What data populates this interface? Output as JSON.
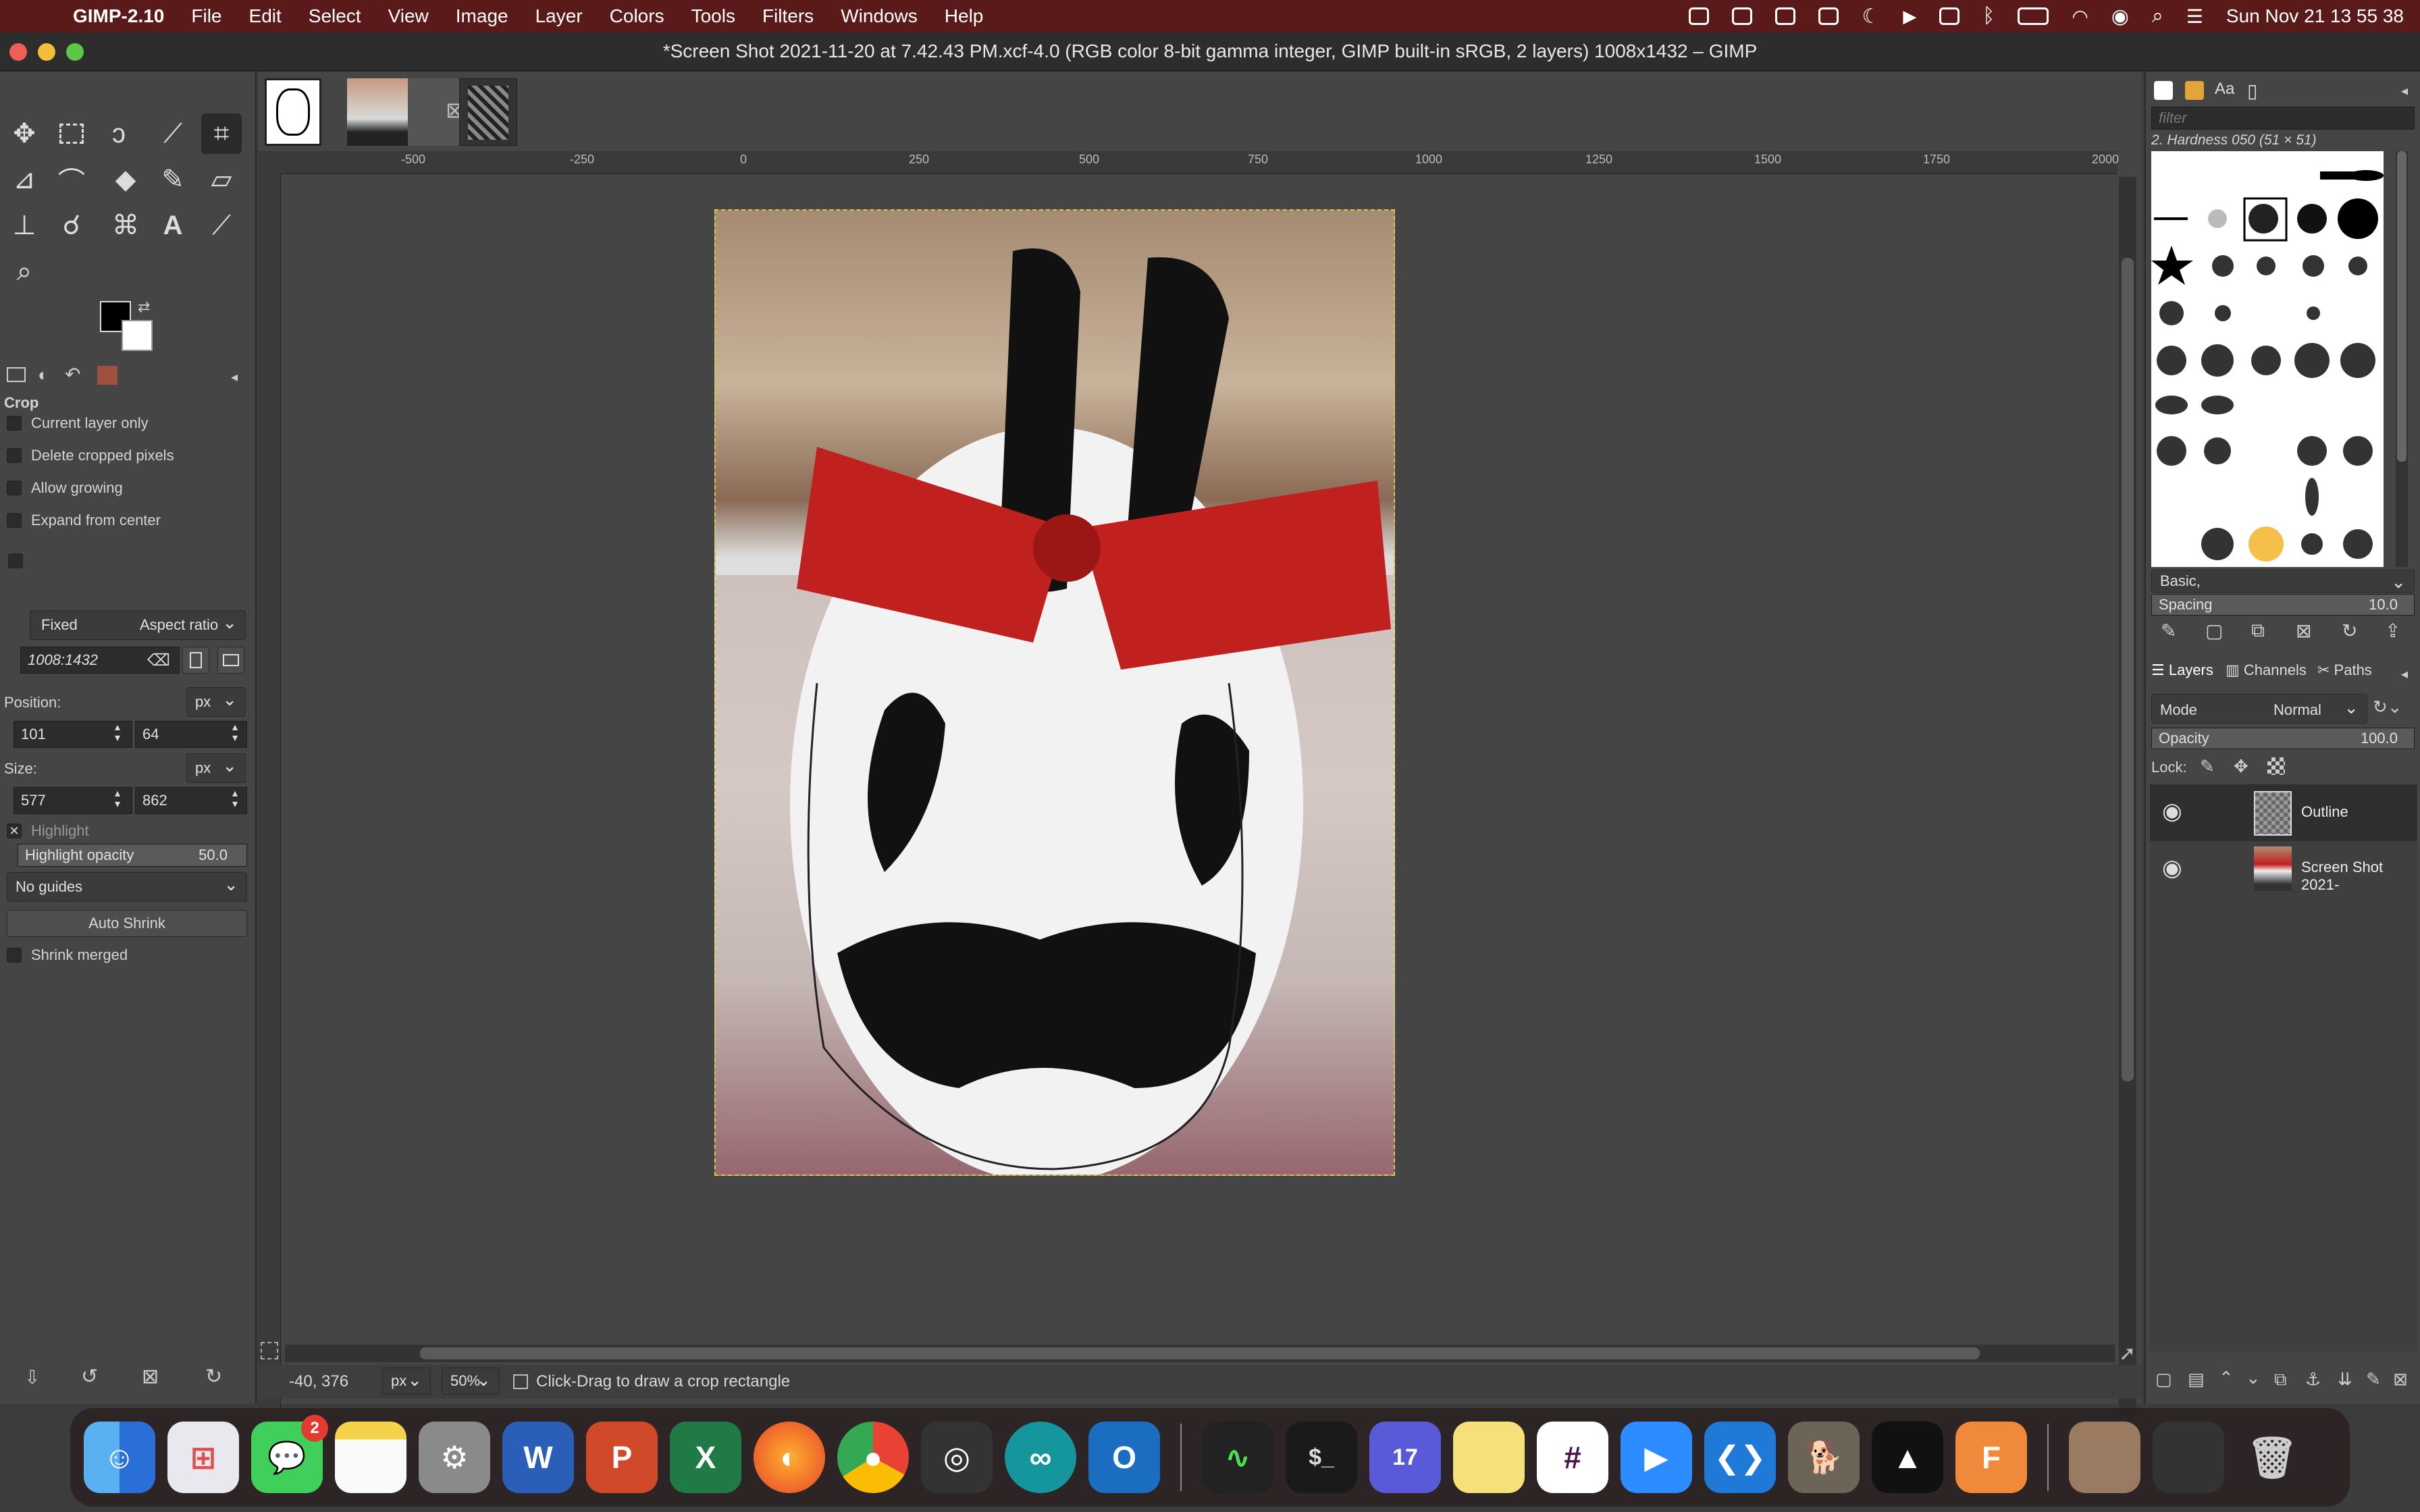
{
  "menubar": {
    "app": "GIMP-2.10",
    "items": [
      "File",
      "Edit",
      "Select",
      "View",
      "Image",
      "Layer",
      "Colors",
      "Tools",
      "Filters",
      "Windows",
      "Help"
    ],
    "clock": "Sun Nov 21  13 55 38"
  },
  "window": {
    "title": "*Screen Shot 2021-11-20 at 7.42.43 PM.xcf-4.0 (RGB color 8-bit gamma integer, GIMP built-in sRGB, 2 layers) 1008x1432 – GIMP"
  },
  "tool_options": {
    "tool_name": "Crop",
    "current_layer_only": "Current layer only",
    "delete_cropped": "Delete cropped pixels",
    "allow_growing": "Allow growing",
    "expand_center": "Expand from center",
    "fixed_label": "Fixed",
    "fixed_value": "Aspect ratio",
    "ratio": "1008:1432",
    "position_label": "Position:",
    "position_unit": "px",
    "pos_x": "101",
    "pos_y": "64",
    "size_label": "Size:",
    "size_unit": "px",
    "size_w": "577",
    "size_h": "862",
    "highlight": "Highlight",
    "highlight_opacity_label": "Highlight opacity",
    "highlight_opacity": "50.0",
    "guides": "No guides",
    "auto_shrink": "Auto Shrink",
    "shrink_merged": "Shrink merged"
  },
  "ruler_labels": [
    "-500",
    "-250",
    "0",
    "250",
    "500",
    "750",
    "1000",
    "1250",
    "1500",
    "1750",
    "2000"
  ],
  "status": {
    "coords": "-40, 376",
    "unit": "px",
    "zoom": "50%",
    "message": "Click-Drag to draw a crop rectangle"
  },
  "brushes": {
    "filter_placeholder": "filter",
    "selected": "2. Hardness 050 (51 × 51)",
    "preset": "Basic,",
    "spacing_label": "Spacing",
    "spacing": "10.0"
  },
  "layers_panel": {
    "tabs": [
      "Layers",
      "Channels",
      "Paths"
    ],
    "mode_label": "Mode",
    "mode": "Normal",
    "opacity_label": "Opacity",
    "opacity": "100.0",
    "lock_label": "Lock:",
    "layers": [
      {
        "name": "Outline"
      },
      {
        "name": "Screen Shot 2021-"
      }
    ]
  },
  "dock": {
    "messages_badge": "2",
    "calendar_badge": "17"
  },
  "colors": {
    "menubar": "#5a1a1a",
    "panel": "#454545",
    "canvas": "#454545"
  }
}
